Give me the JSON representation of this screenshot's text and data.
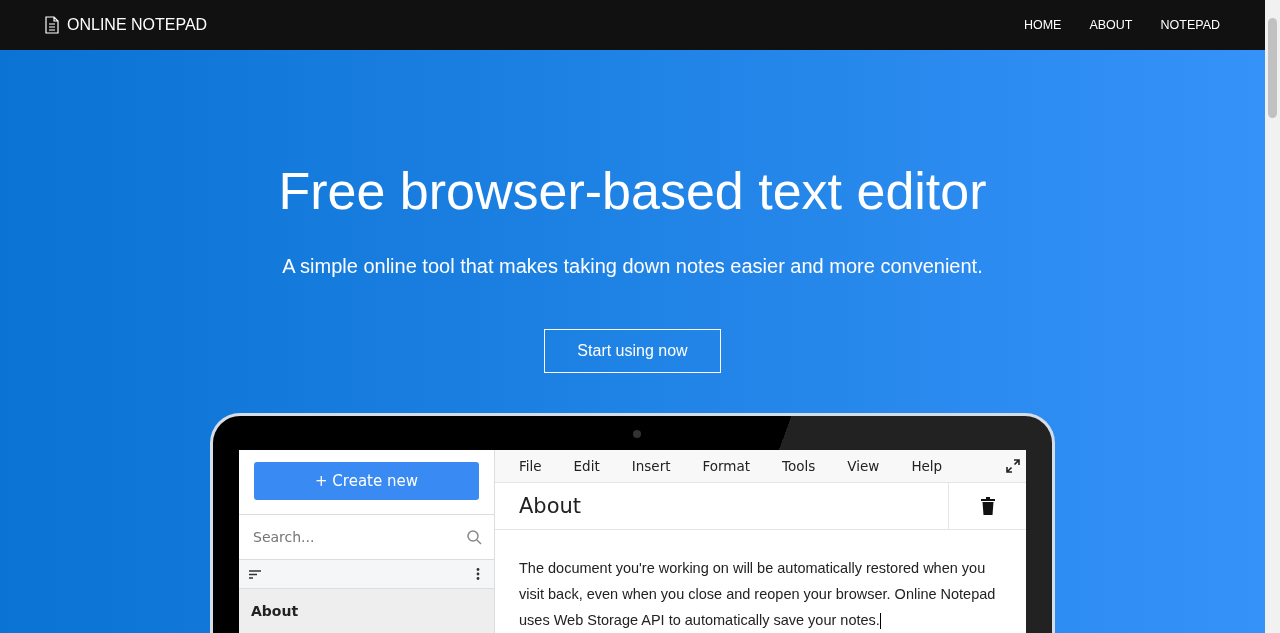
{
  "navbar": {
    "brand": "ONLINE NOTEPAD",
    "links": [
      {
        "label": "HOME"
      },
      {
        "label": "ABOUT"
      },
      {
        "label": "NOTEPAD"
      }
    ]
  },
  "hero": {
    "title": "Free browser-based text editor",
    "subtitle": "A simple online tool that makes taking down notes easier and more convenient.",
    "cta": "Start using now"
  },
  "app_preview": {
    "create_button": "+ Create new",
    "search": {
      "placeholder": "Search..."
    },
    "notes": [
      {
        "title": "About",
        "selected": true
      }
    ],
    "menu": [
      "File",
      "Edit",
      "Insert",
      "Format",
      "Tools",
      "View",
      "Help"
    ],
    "note_title": "About",
    "body": "The document you're working on will be automatically restored when you visit back, even when you close and reopen your browser. Online Notepad uses Web Storage API to automatically save your notes."
  }
}
